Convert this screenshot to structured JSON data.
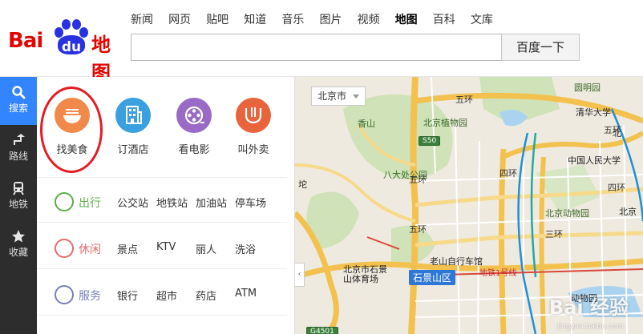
{
  "logo": {
    "part1": "Bai",
    "du": "du",
    "part2": "地图"
  },
  "nav": [
    "新闻",
    "网页",
    "贴吧",
    "知道",
    "音乐",
    "图片",
    "视频",
    "地图",
    "百科",
    "文库"
  ],
  "nav_active": "地图",
  "search": {
    "value": "",
    "button": "百度一下"
  },
  "rail": [
    {
      "label": "搜索",
      "icon": "search-icon"
    },
    {
      "label": "路线",
      "icon": "route-icon"
    },
    {
      "label": "地铁",
      "icon": "subway-icon"
    },
    {
      "label": "收藏",
      "icon": "star-icon"
    }
  ],
  "quick": [
    {
      "label": "找美食",
      "icon": "food-bowl-icon",
      "color": "#f0894a"
    },
    {
      "label": "订酒店",
      "icon": "hotel-icon",
      "color": "#3aa0e0"
    },
    {
      "label": "看电影",
      "icon": "film-reel-icon",
      "color": "#9a6bc6"
    },
    {
      "label": "叫外卖",
      "icon": "fork-knife-icon",
      "color": "#e8643c"
    }
  ],
  "categories": [
    {
      "name": "出行",
      "color": "#5dae4a",
      "items": [
        "公交站",
        "地铁站",
        "加油站",
        "停车场"
      ]
    },
    {
      "name": "休闲",
      "color": "#e86b6b",
      "items": [
        "景点",
        "KTV",
        "丽人",
        "洗浴"
      ]
    },
    {
      "name": "服务",
      "color": "#7a7fb8",
      "items": [
        "银行",
        "超市",
        "药店",
        "ATM"
      ]
    }
  ],
  "map": {
    "city": "北京市",
    "pois": [
      "圆明园",
      "清华大学",
      "香山",
      "北京植物园",
      "中国人民大学",
      "八大处公园",
      "北京动物园",
      "北京市石景山体育场",
      "老山自行车馆",
      "石景山区"
    ],
    "road_labels": [
      "五环",
      "四环",
      "三环",
      "五环",
      "四环",
      "五环",
      "五环"
    ],
    "shields": [
      "S50",
      "G4501"
    ],
    "subway": "地铁1号线",
    "small_labels": [
      "北",
      "坨",
      "动物园",
      "北京"
    ],
    "watermark": "Bai 经验",
    "watermark_sub": "jingyan.baidu.com"
  }
}
